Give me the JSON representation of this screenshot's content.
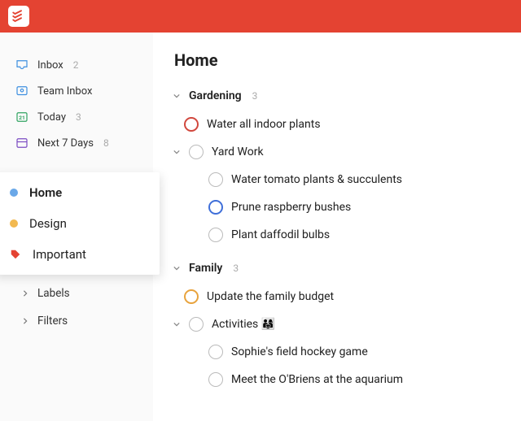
{
  "app": {
    "name": "Todoist"
  },
  "colors": {
    "brand": "#e44332"
  },
  "sidebar": {
    "nav": [
      {
        "label": "Inbox",
        "count": "2",
        "icon": "inbox-icon"
      },
      {
        "label": "Team Inbox",
        "count": "",
        "icon": "team-inbox-icon"
      },
      {
        "label": "Today",
        "count": "3",
        "icon": "today-icon"
      },
      {
        "label": "Next 7 Days",
        "count": "8",
        "icon": "next7-icon"
      }
    ],
    "projects": [
      {
        "label": "Home",
        "color": "#6aa8e8",
        "active": true
      },
      {
        "label": "Design",
        "color": "#f2b950",
        "active": false
      }
    ],
    "tag": {
      "label": "Important"
    },
    "subs": [
      {
        "label": "Labels"
      },
      {
        "label": "Filters"
      }
    ]
  },
  "main": {
    "title": "Home",
    "sections": [
      {
        "name": "Gardening",
        "count": "3",
        "tasks": [
          {
            "text": "Water all indoor plants",
            "priority": "red",
            "indent": 1
          },
          {
            "text": "Yard Work",
            "priority": "none",
            "indent": 1,
            "expandable": true
          },
          {
            "text": "Water tomato plants & succulents",
            "priority": "none",
            "indent": 2
          },
          {
            "text": "Prune raspberry bushes",
            "priority": "blue",
            "indent": 2
          },
          {
            "text": "Plant daffodil bulbs",
            "priority": "none",
            "indent": 2
          }
        ]
      },
      {
        "name": "Family",
        "count": "3",
        "tasks": [
          {
            "text": "Update the family budget",
            "priority": "amber",
            "indent": 1
          },
          {
            "text": "Activities 👨‍👩‍👧",
            "priority": "none",
            "indent": 1,
            "expandable": true
          },
          {
            "text": "Sophie's field hockey game",
            "priority": "none",
            "indent": 2
          },
          {
            "text": "Meet the O'Briens at the aquarium",
            "priority": "none",
            "indent": 2
          }
        ]
      }
    ]
  }
}
